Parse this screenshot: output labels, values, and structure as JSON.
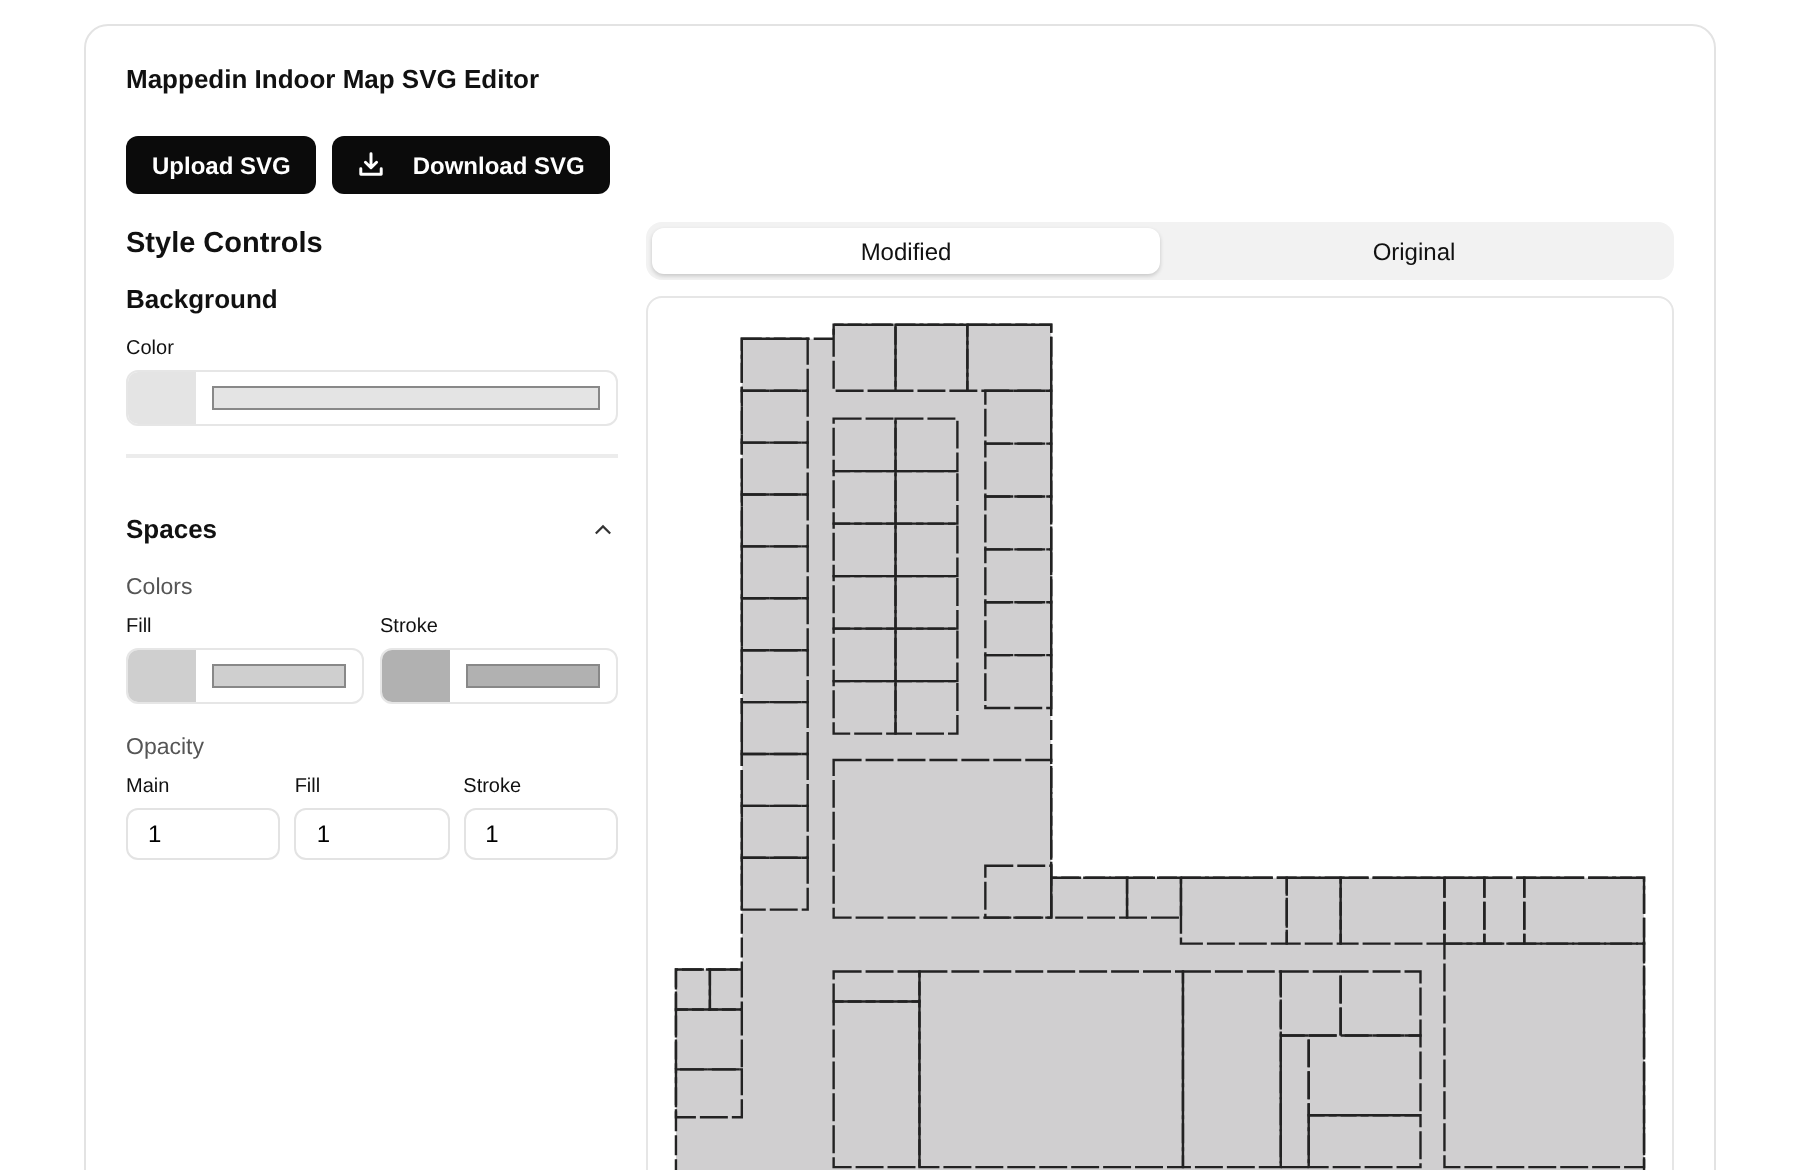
{
  "title": "Mappedin Indoor Map SVG Editor",
  "buttons": [
    {
      "label": "Upload SVG",
      "kind": "upload"
    },
    {
      "label": "Download SVG",
      "kind": "download"
    }
  ],
  "style_controls": {
    "heading": "Style Controls",
    "background": {
      "heading": "Background",
      "color_label": "Color",
      "color": "#e4e4e4"
    },
    "spaces": {
      "heading": "Spaces",
      "expanded": true,
      "colors_label": "Colors",
      "colors": [
        {
          "label": "Fill",
          "color": "#cfcfcf"
        },
        {
          "label": "Stroke",
          "color": "#b1b1b1"
        }
      ],
      "opacity_label": "Opacity",
      "opacity": [
        {
          "label": "Main",
          "value": "1"
        },
        {
          "label": "Fill",
          "value": "1"
        },
        {
          "label": "Stroke",
          "value": "1"
        }
      ]
    }
  },
  "tabs": [
    {
      "label": "Modified",
      "selected": true
    },
    {
      "label": "Original",
      "selected": false
    }
  ]
}
